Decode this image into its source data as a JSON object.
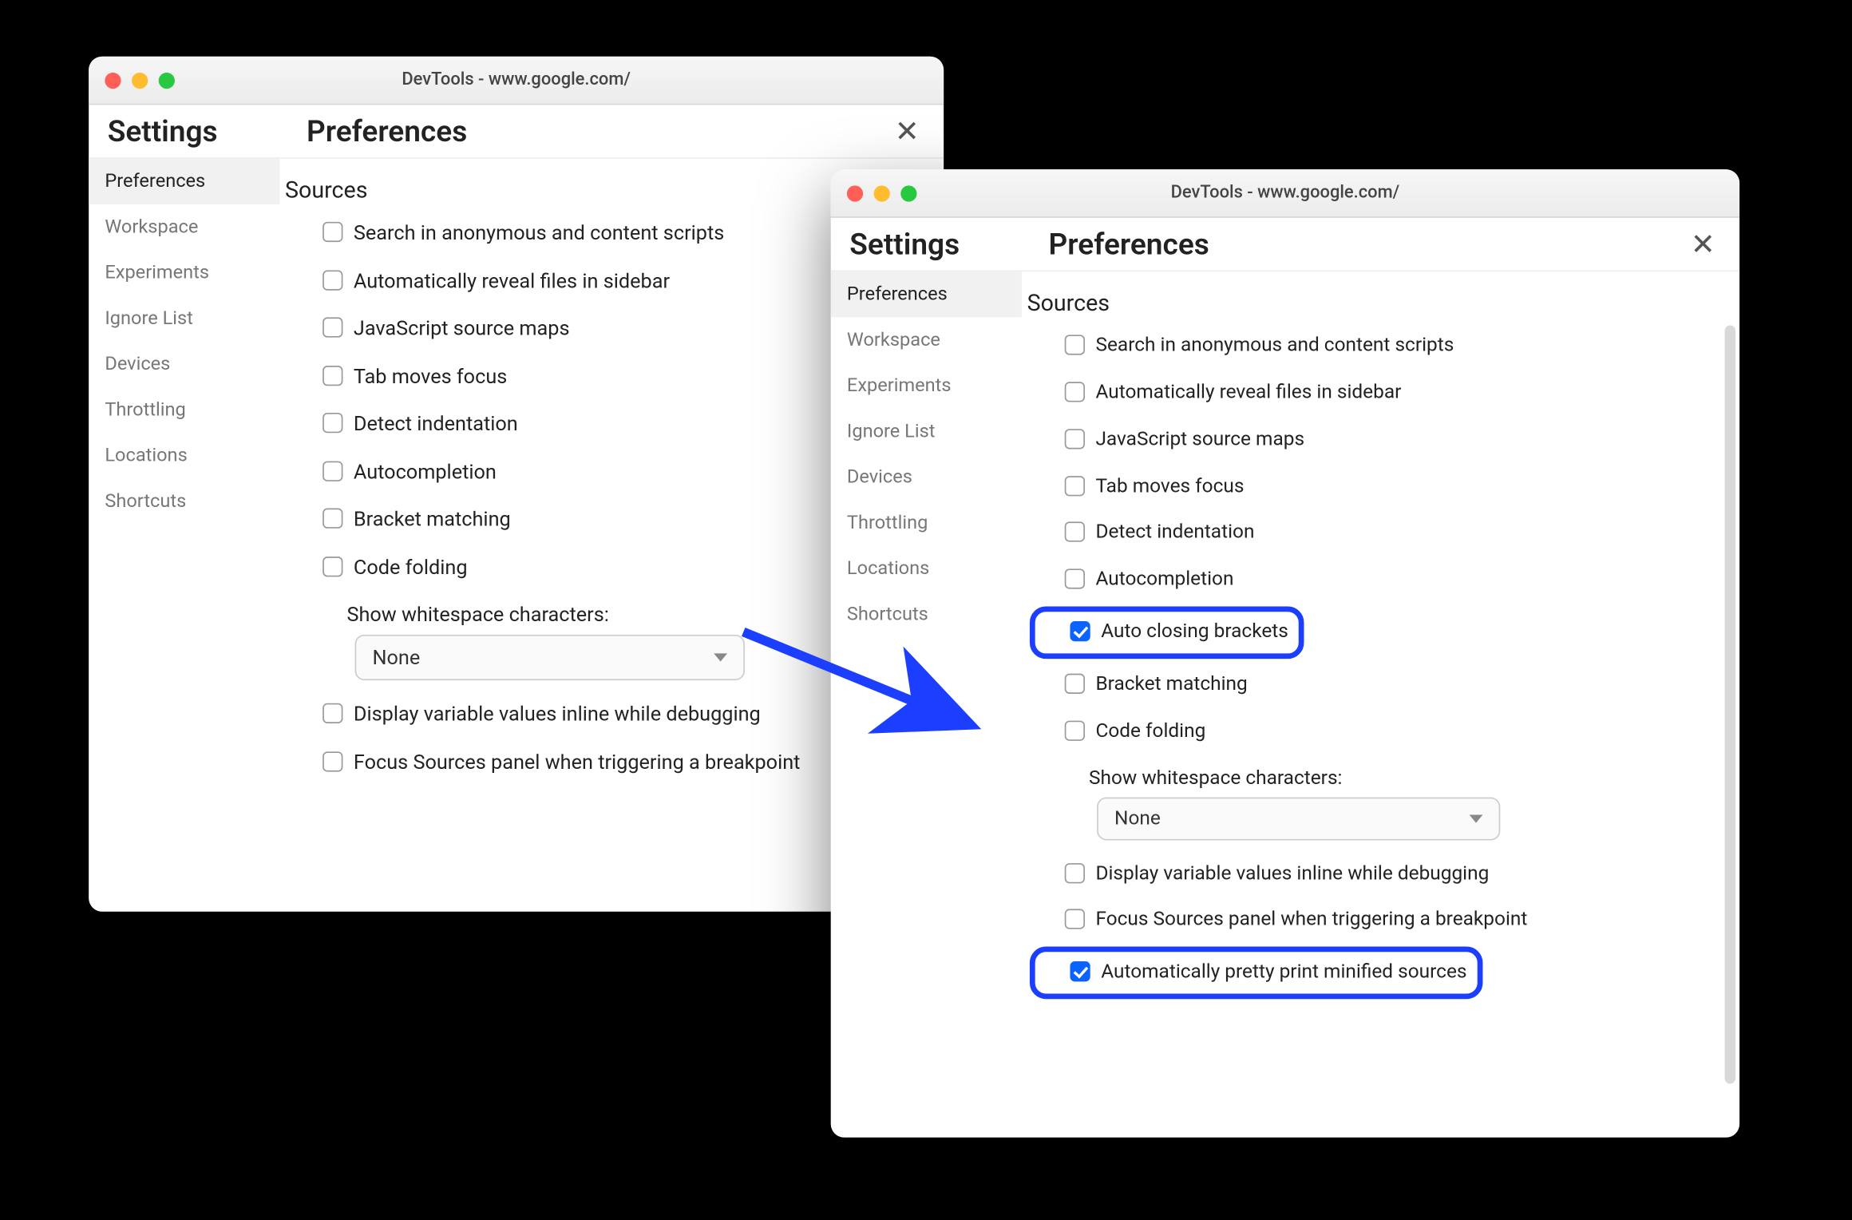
{
  "colors": {
    "highlight": "#1c3fff",
    "accent": "#0a63ff"
  },
  "left": {
    "title": "DevTools - www.google.com/",
    "settings_label": "Settings",
    "page_title": "Preferences",
    "sidebar": [
      {
        "label": "Preferences",
        "selected": true
      },
      {
        "label": "Workspace",
        "selected": false
      },
      {
        "label": "Experiments",
        "selected": false
      },
      {
        "label": "Ignore List",
        "selected": false
      },
      {
        "label": "Devices",
        "selected": false
      },
      {
        "label": "Throttling",
        "selected": false
      },
      {
        "label": "Locations",
        "selected": false
      },
      {
        "label": "Shortcuts",
        "selected": false
      }
    ],
    "section": "Sources",
    "options": [
      {
        "label": "Search in anonymous and content scripts",
        "checked": false
      },
      {
        "label": "Automatically reveal files in sidebar",
        "checked": false
      },
      {
        "label": "JavaScript source maps",
        "checked": false
      },
      {
        "label": "Tab moves focus",
        "checked": false
      },
      {
        "label": "Detect indentation",
        "checked": false
      },
      {
        "label": "Autocompletion",
        "checked": false
      },
      {
        "label": "Bracket matching",
        "checked": false
      },
      {
        "label": "Code folding",
        "checked": false
      }
    ],
    "whitespace_label": "Show whitespace characters:",
    "whitespace_value": "None",
    "options2": [
      {
        "label": "Display variable values inline while debugging",
        "checked": false
      },
      {
        "label": "Focus Sources panel when triggering a breakpoint",
        "checked": false
      }
    ]
  },
  "right": {
    "title": "DevTools - www.google.com/",
    "settings_label": "Settings",
    "page_title": "Preferences",
    "sidebar": [
      {
        "label": "Preferences",
        "selected": true
      },
      {
        "label": "Workspace",
        "selected": false
      },
      {
        "label": "Experiments",
        "selected": false
      },
      {
        "label": "Ignore List",
        "selected": false
      },
      {
        "label": "Devices",
        "selected": false
      },
      {
        "label": "Throttling",
        "selected": false
      },
      {
        "label": "Locations",
        "selected": false
      },
      {
        "label": "Shortcuts",
        "selected": false
      }
    ],
    "section": "Sources",
    "options": [
      {
        "label": "Search in anonymous and content scripts",
        "checked": false
      },
      {
        "label": "Automatically reveal files in sidebar",
        "checked": false
      },
      {
        "label": "JavaScript source maps",
        "checked": false
      },
      {
        "label": "Tab moves focus",
        "checked": false
      },
      {
        "label": "Detect indentation",
        "checked": false
      },
      {
        "label": "Autocompletion",
        "checked": false
      },
      {
        "label": "Auto closing brackets",
        "checked": true,
        "highlight": true
      },
      {
        "label": "Bracket matching",
        "checked": false
      },
      {
        "label": "Code folding",
        "checked": false
      }
    ],
    "whitespace_label": "Show whitespace characters:",
    "whitespace_value": "None",
    "options2": [
      {
        "label": "Display variable values inline while debugging",
        "checked": false
      },
      {
        "label": "Focus Sources panel when triggering a breakpoint",
        "checked": false
      },
      {
        "label": "Automatically pretty print minified sources",
        "checked": true,
        "highlight": true
      }
    ]
  }
}
